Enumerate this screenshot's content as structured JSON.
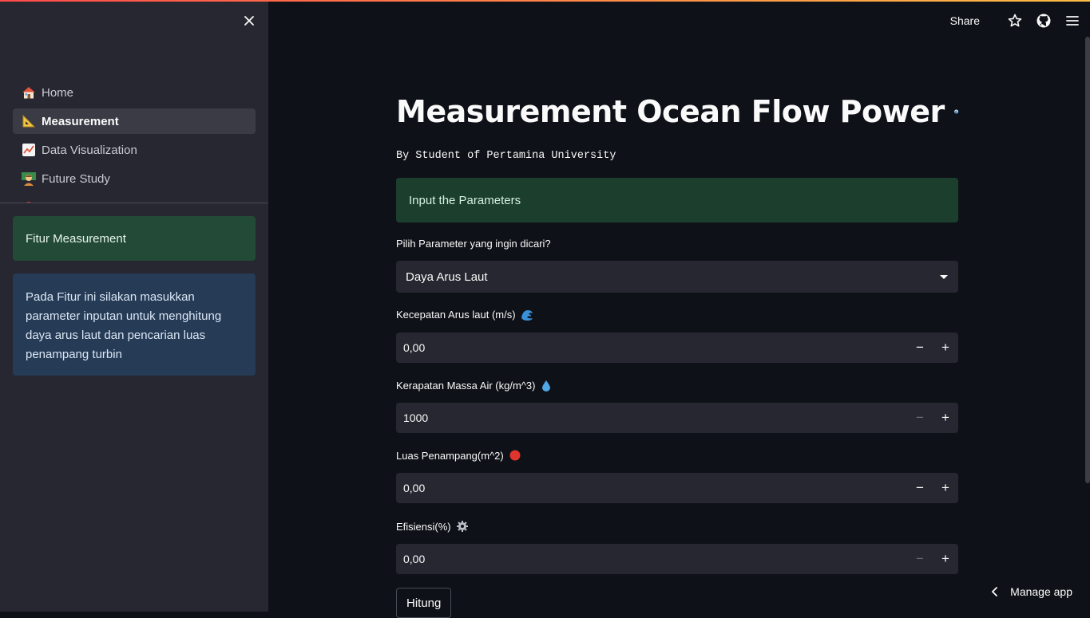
{
  "header": {
    "share_label": "Share",
    "icons": [
      "star-icon",
      "github-icon",
      "menu-icon"
    ]
  },
  "sidebar": {
    "close_icon": "close-icon",
    "nav": [
      {
        "icon": "house-icon",
        "label": "Home",
        "active": false
      },
      {
        "icon": "triangular-ruler-icon",
        "label": "Measurement",
        "active": true
      },
      {
        "icon": "chart-increasing-icon",
        "label": "Data Visualization",
        "active": false
      },
      {
        "icon": "teacher-icon",
        "label": "Future Study",
        "active": false
      }
    ],
    "feature_title": "Fitur Measurement",
    "feature_desc": "Pada Fitur ini silakan masukkan parameter inputan untuk menghitung daya arus laut dan pencarian luas penampang turbin"
  },
  "main": {
    "title": "Measurement Ocean Flow Power",
    "title_icon": "water-wave-icon",
    "subtitle": "By Student of Pertamina University",
    "info": "Input the Parameters",
    "select_label": "Pilih Parameter yang ingin dicari?",
    "select_value": "Daya Arus Laut",
    "inputs": [
      {
        "label": "Kecepatan Arus laut (m/s)",
        "icon": "water-wave-icon",
        "value": "0,00",
        "minus_disabled": false
      },
      {
        "label": "Kerapatan Massa Air (kg/m^3)",
        "icon": "droplet-icon",
        "value": "1000",
        "minus_disabled": true
      },
      {
        "label": "Luas Penampang(m^2)",
        "icon": "red-circle-icon",
        "value": "0,00",
        "minus_disabled": false
      },
      {
        "label": "Efisiensi(%)",
        "icon": "gear-icon",
        "value": "0,00",
        "minus_disabled": true
      }
    ],
    "button_label": "Hitung"
  },
  "footer": {
    "manage_app": "Manage app"
  }
}
